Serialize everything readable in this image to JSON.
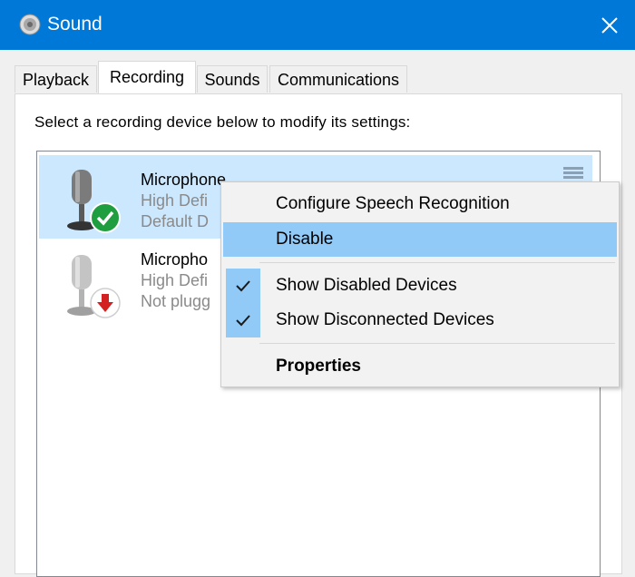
{
  "window": {
    "title": "Sound",
    "icon": "speaker-icon",
    "close_icon": "close-icon"
  },
  "tabs": [
    {
      "label": "Playback",
      "active": false
    },
    {
      "label": "Recording",
      "active": true
    },
    {
      "label": "Sounds",
      "active": false
    },
    {
      "label": "Communications",
      "active": false
    }
  ],
  "instruction": "Select a recording device below to modify its settings:",
  "devices": [
    {
      "name": "Microphone",
      "line2": "High Defi",
      "line3": "Default D",
      "status_icon": "green-check-icon",
      "selected": true
    },
    {
      "name": "Micropho",
      "line2": "High Defi",
      "line3": "Not plugg",
      "status_icon": "red-down-arrow-icon",
      "selected": false
    }
  ],
  "context_menu": {
    "items": [
      {
        "label": "Configure Speech Recognition",
        "checked": false,
        "highlighted": false,
        "bold": false
      },
      {
        "label": "Disable",
        "checked": false,
        "highlighted": true,
        "bold": false
      },
      {
        "label": "Show Disabled Devices",
        "checked": true,
        "highlighted": false,
        "bold": false
      },
      {
        "label": "Show Disconnected Devices",
        "checked": true,
        "highlighted": false,
        "bold": false
      },
      {
        "label": "Properties",
        "checked": false,
        "highlighted": false,
        "bold": true
      }
    ]
  },
  "colors": {
    "titlebar": "#0078d7",
    "selection": "#cce8ff",
    "menu_highlight": "#91c9f7",
    "default_badge": "#1e9e3e",
    "unplugged_badge": "#d32020"
  }
}
